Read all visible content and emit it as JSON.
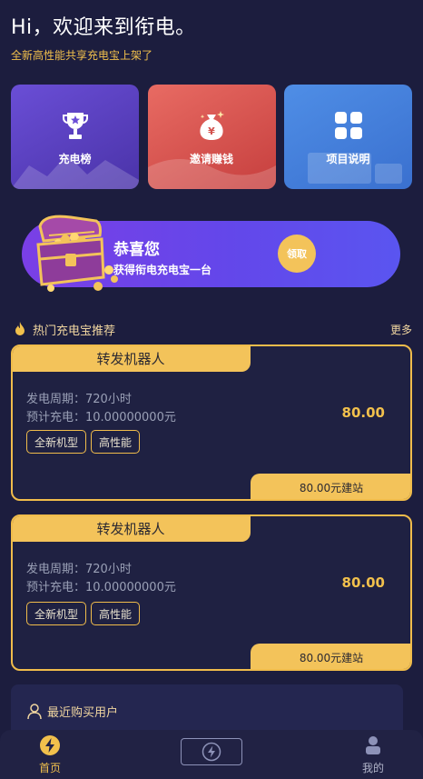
{
  "header": {
    "greeting": "Hi，欢迎来到衔电。",
    "subtitle": "全新高性能共享充电宝上架了"
  },
  "features": [
    {
      "label": "充电榜",
      "icon": "trophy-icon"
    },
    {
      "label": "邀请赚钱",
      "icon": "money-bag-icon"
    },
    {
      "label": "项目说明",
      "icon": "grid-icon"
    }
  ],
  "banner": {
    "title": "恭喜您",
    "text": "获得衔电充电宝一台",
    "button": "领取"
  },
  "section": {
    "title": "热门充电宝推荐",
    "more": "更多"
  },
  "products": [
    {
      "name": "转发机器人",
      "cycle": "发电周期：720小时",
      "expected": "预计充电：10.00000000元",
      "price": "80.00",
      "tags": [
        "全新机型",
        "高性能"
      ],
      "buy": "80.00元建站"
    },
    {
      "name": "转发机器人",
      "cycle": "发电周期：720小时",
      "expected": "预计充电：10.00000000元",
      "price": "80.00",
      "tags": [
        "全新机型",
        "高性能"
      ],
      "buy": "80.00元建站"
    }
  ],
  "recent": {
    "title": "最近购买用户"
  },
  "tabbar": {
    "home": "首页",
    "mine": "我的"
  },
  "colors": {
    "accent": "#f1c04c",
    "background": "#1c1d3e"
  }
}
